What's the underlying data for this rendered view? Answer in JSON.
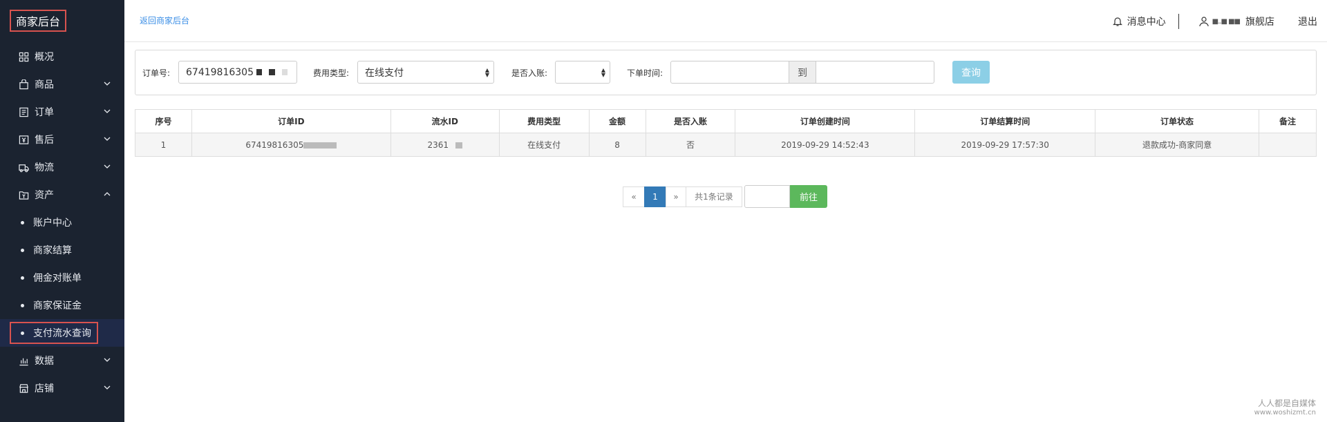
{
  "brand": {
    "title": "商家后台"
  },
  "sidebar": {
    "items": [
      {
        "label": "概况",
        "icon": "grid-icon"
      },
      {
        "label": "商品",
        "icon": "bag-icon"
      },
      {
        "label": "订单",
        "icon": "list-icon"
      },
      {
        "label": "售后",
        "icon": "yen-box-icon"
      },
      {
        "label": "物流",
        "icon": "truck-icon"
      },
      {
        "label": "资产",
        "icon": "yen-folder-icon"
      },
      {
        "label": "账户中心"
      },
      {
        "label": "商家结算"
      },
      {
        "label": "佣金对账单"
      },
      {
        "label": "商家保证金"
      },
      {
        "label": "支付流水查询"
      },
      {
        "label": "数据",
        "icon": "bar-chart-icon"
      },
      {
        "label": "店铺",
        "icon": "store-icon"
      }
    ]
  },
  "header": {
    "back_link": "返回商家后台",
    "messages": "消息中心",
    "store_name_visible": "旗舰店",
    "store_name_mask": "■..■ ■■",
    "logout": "退出"
  },
  "filter": {
    "order_no_label": "订单号:",
    "order_no_value": "67419816305",
    "fee_type_label": "费用类型:",
    "fee_type_value": "在线支付",
    "booked_label": "是否入账:",
    "booked_value": "",
    "order_time_label": "下单时间:",
    "to_label": "到",
    "query_button": "查询"
  },
  "table": {
    "headers": [
      "序号",
      "订单ID",
      "流水ID",
      "费用类型",
      "金额",
      "是否入账",
      "订单创建时间",
      "订单结算时间",
      "订单状态",
      "备注"
    ],
    "rows": [
      [
        "1",
        "67419816305",
        "2361",
        "在线支付",
        "8",
        "否",
        "2019-09-29 14:52:43",
        "2019-09-29 17:57:30",
        "退款成功-商家同意",
        ""
      ]
    ]
  },
  "pagination": {
    "prev": "«",
    "current": "1",
    "next": "»",
    "total": "共1条记录",
    "goto_button": "前往"
  },
  "watermark": {
    "line1": "人人都是自媒体",
    "line2": "www.woshizmt.cn"
  },
  "colors": {
    "sidebar_bg": "#1b2330",
    "highlight_border": "#d9534f",
    "link": "#3a8ee6",
    "query_btn": "#8ccfe6",
    "page_active": "#337ab7",
    "goto_btn": "#5cb85c"
  }
}
